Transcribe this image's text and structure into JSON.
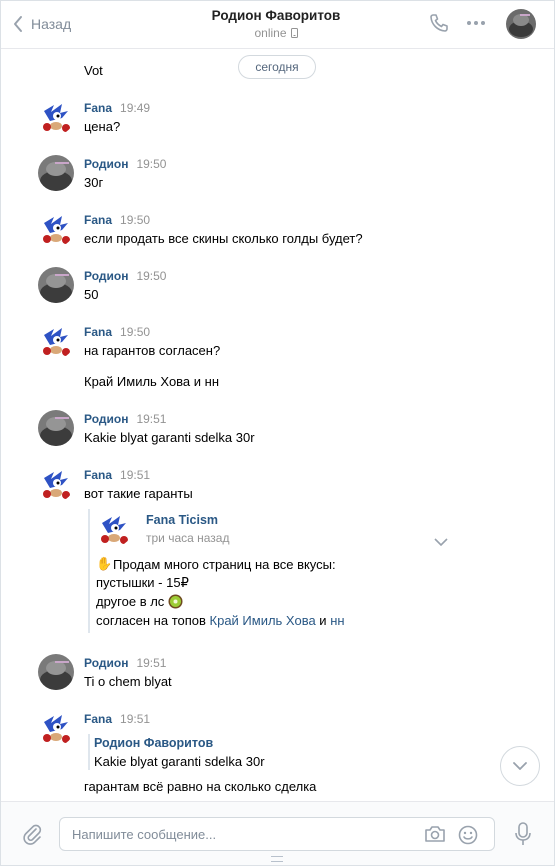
{
  "header": {
    "back_label": "Назад",
    "title": "Родион Фаворитов",
    "status": "online"
  },
  "date_pill": "сегодня",
  "messages": [
    {
      "text": "Vot"
    },
    {
      "sender": "Fana",
      "time": "19:49",
      "text": "цена?"
    },
    {
      "sender": "Родион",
      "time": "19:50",
      "text": "30г"
    },
    {
      "sender": "Fana",
      "time": "19:50",
      "text": "если продать все скины сколько голды будет?"
    },
    {
      "sender": "Родион",
      "time": "19:50",
      "text": "50"
    },
    {
      "sender": "Fana",
      "time": "19:50",
      "text": "на гарантов согласен?",
      "text2": "Край Имиль Хова и нн"
    },
    {
      "sender": "Родион",
      "time": "19:51",
      "text": "Kakie blyat garanti sdelka 30r"
    },
    {
      "sender": "Fana",
      "time": "19:51",
      "text": "вот такие гаранты"
    },
    {
      "sender": "Родион",
      "time": "19:51",
      "text": "Ti o chem blyat"
    },
    {
      "sender": "Fana",
      "time": "19:51",
      "text": "гарантам всё равно на сколько сделка"
    }
  ],
  "forwarded": {
    "name": "Fana Ticism",
    "time": "три часа назад",
    "line1": "Продам много страниц на все вкусы:",
    "line2": "пустышки - 15₽",
    "line3": "другое в лс",
    "line4_prefix": "согласен на топов ",
    "line4_link1": "Край Имиль Хова",
    "line4_mid": " и ",
    "line4_link2": "нн"
  },
  "quote": {
    "name": "Родион Фаворитов",
    "text": "Kakie blyat garanti sdelka 30r"
  },
  "composer": {
    "placeholder": "Напишите сообщение..."
  },
  "colors": {
    "link": "#2a5885",
    "muted": "#939393",
    "accent": "#818c99"
  }
}
